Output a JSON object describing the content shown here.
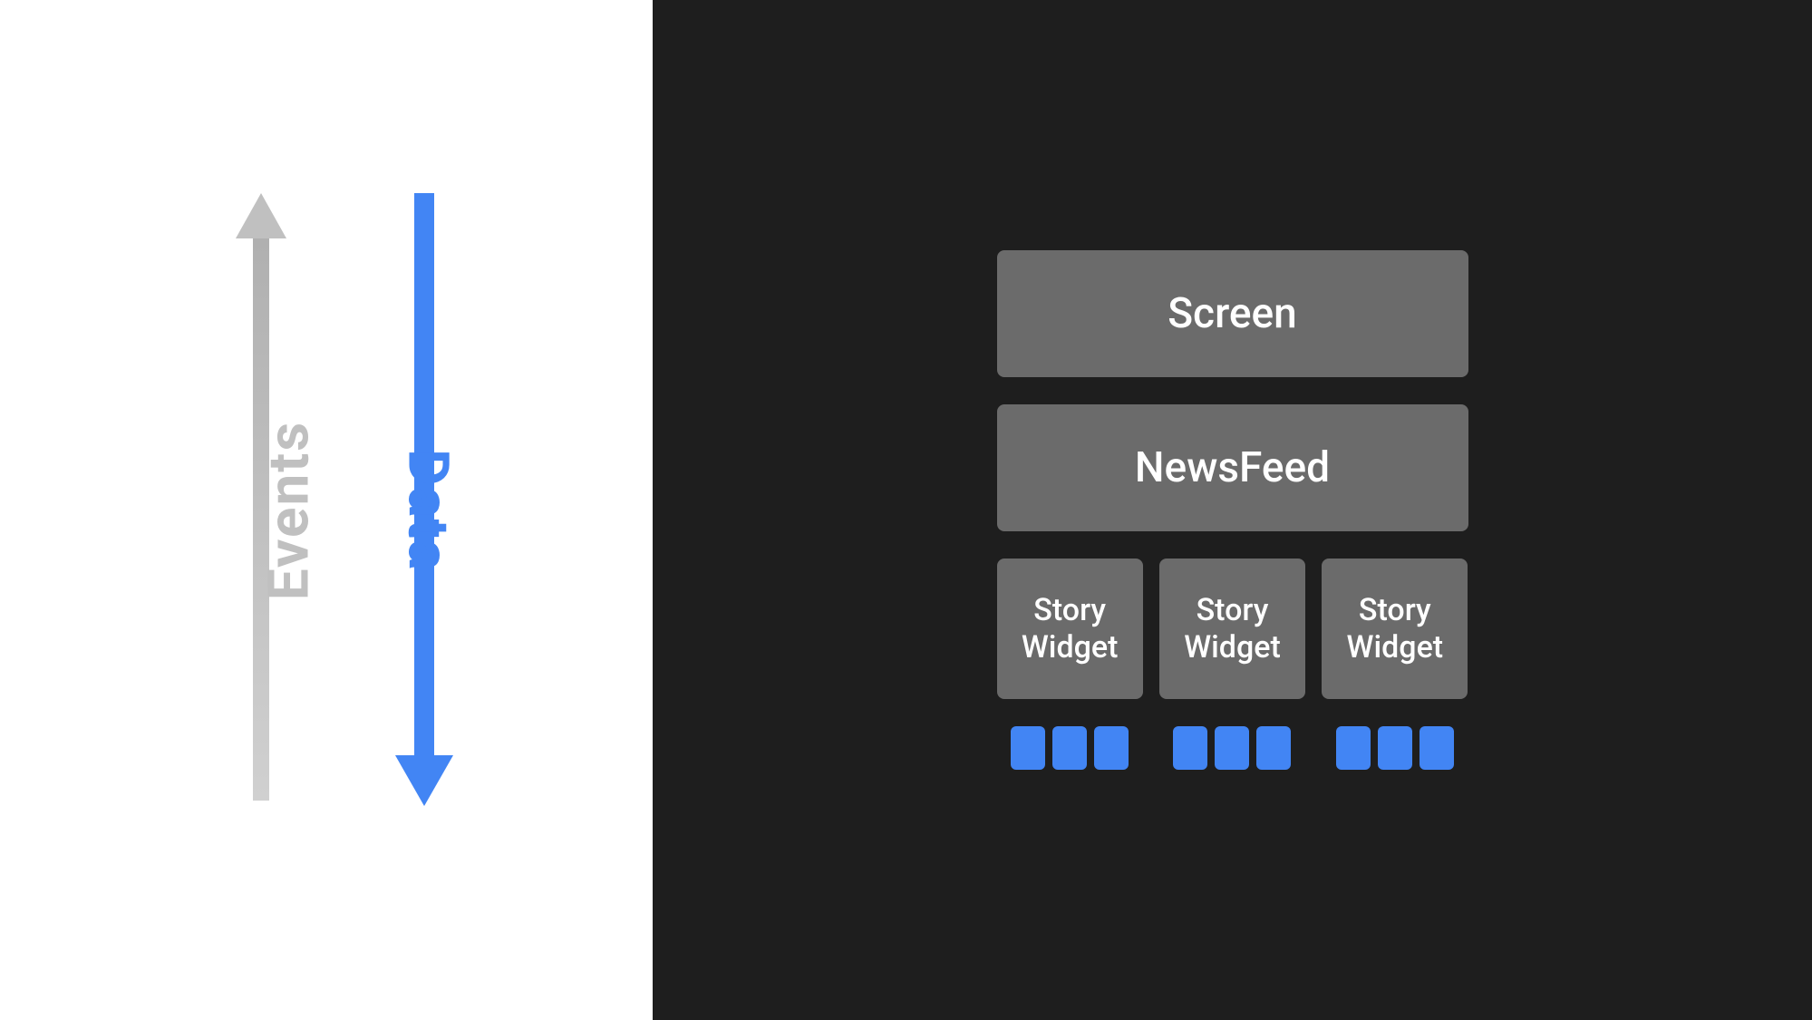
{
  "left": {
    "events_label": "Events",
    "data_label": "Data"
  },
  "right": {
    "screen_label": "Screen",
    "newsfeed_label": "NewsFeed",
    "story_widget_1": "Story\nWidget",
    "story_widget_2": "Story\nWidget",
    "story_widget_3": "Story\nWidget"
  },
  "colors": {
    "blue": "#4285f4",
    "gray_box": "#6b6b6b",
    "dark_bg": "#1e1e1e",
    "light_bg": "#ffffff",
    "events_gray": "#c0c0c0"
  }
}
